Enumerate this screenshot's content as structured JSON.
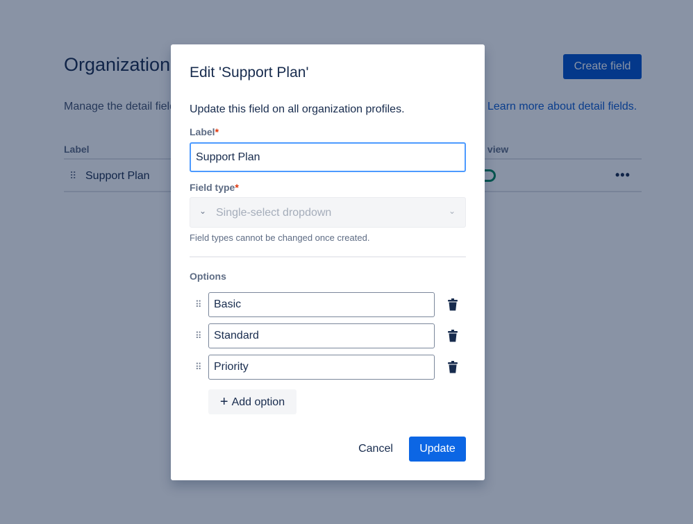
{
  "page": {
    "title": "Organization detail fields",
    "create_label": "Create field",
    "description": "Manage the detail fields for organization profiles.",
    "learn_more": "Learn more about detail fields.",
    "columns": [
      "Label",
      "Show on issue view"
    ],
    "rows": [
      {
        "label": "Support Plan",
        "show_on_issue_view": true
      }
    ],
    "more_label": "•••"
  },
  "modal": {
    "title": "Edit 'Support Plan'",
    "subtitle": "Update this field on all organization profiles.",
    "label_field": {
      "label": "Label",
      "required": "*",
      "value": "Support Plan"
    },
    "field_type": {
      "label": "Field type",
      "required": "*",
      "value": "Single-select dropdown",
      "hint": "Field types cannot be changed once created."
    },
    "options_label": "Options",
    "options": [
      "Basic",
      "Standard",
      "Priority"
    ],
    "add_option": "Add option",
    "cancel": "Cancel",
    "update": "Update"
  },
  "colors": {
    "primary": "#0c66e4",
    "toggle_on": "#00875a",
    "focus": "#4c9aff"
  }
}
